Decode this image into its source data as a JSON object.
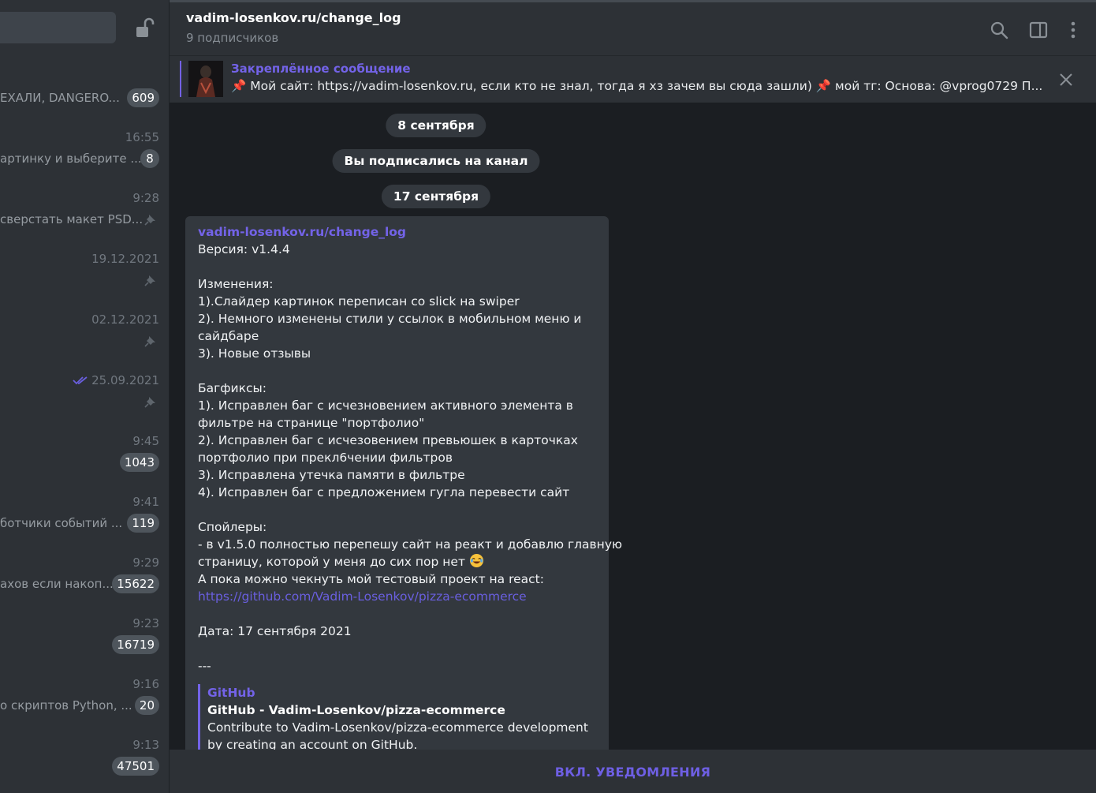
{
  "sidebar": {
    "chats": [
      {
        "time": "",
        "preview": "ЕХАЛИ, DANGERO...",
        "badge": "609",
        "pinned": false,
        "read_check": false
      },
      {
        "time": "16:55",
        "preview": "артинку и выберите ...",
        "badge": "8",
        "pinned": false,
        "read_check": false
      },
      {
        "time": "9:28",
        "preview": "сверстать макет PSD...",
        "badge": "",
        "pinned": true,
        "read_check": false
      },
      {
        "time": "19.12.2021",
        "preview": "",
        "badge": "",
        "pinned": true,
        "read_check": false
      },
      {
        "time": "02.12.2021",
        "preview": "",
        "badge": "",
        "pinned": true,
        "read_check": false
      },
      {
        "time": "25.09.2021",
        "preview": "",
        "badge": "",
        "pinned": true,
        "read_check": true
      },
      {
        "time": "9:45",
        "preview": "",
        "badge": "1043",
        "pinned": false,
        "read_check": false
      },
      {
        "time": "9:41",
        "preview": "ботчики событий ...",
        "badge": "119",
        "pinned": false,
        "read_check": false
      },
      {
        "time": "9:29",
        "preview": "ахов если накоп...",
        "badge": "15622",
        "pinned": false,
        "read_check": false
      },
      {
        "time": "9:23",
        "preview": "",
        "badge": "16719",
        "pinned": false,
        "read_check": false
      },
      {
        "time": "9:16",
        "preview": "о скриптов Python, ...",
        "badge": "20",
        "pinned": false,
        "read_check": false
      },
      {
        "time": "9:13",
        "preview": "",
        "badge": "47501",
        "pinned": false,
        "read_check": false
      }
    ]
  },
  "header": {
    "title": "vadim-losenkov.ru/change_log",
    "subtitle": "9 подписчиков",
    "icons": [
      "search-icon",
      "sidebar-toggle-icon",
      "more-vertical-icon"
    ]
  },
  "pinned": {
    "title": "Закреплённое сообщение",
    "text": "📌 Мой сайт: https://vadim-losenkov.ru, если кто не знал, тогда я хз зачем вы сюда зашли) 📌 мой тг:     Основа: @vprog0729     П..."
  },
  "service": {
    "date1": "8 сентября",
    "subscribed": "Вы подписались на канал",
    "date2": "17 сентября"
  },
  "message": {
    "channel": "vadim-losenkov.ru/change_log",
    "lines": [
      "Версия: v1.4.4",
      "",
      "Изменения:",
      "1).Слайдер картинок переписан со slick на swiper",
      "2). Немного изменены стили у ссылок в мобильном меню и",
      "сайдбаре",
      "3). Новые отзывы",
      "",
      "Багфиксы:",
      "1). Исправлен баг с исчезновением активного элемента в",
      "фильтре на странице \"портфолио\"",
      "2). Исправлен баг с исчезовением превьюшек в карточках",
      "портфолио при прекл6чении фильтров",
      "3). Исправлена утечка памяти в фильтре",
      "4). Исправлен баг с предложением гугла перевести сайт",
      "",
      "Спойлеры:",
      "- в v1.5.0 полностью перепешу сайт на реакт и добавлю главную"
    ],
    "spoiler_line2": "страницу, которой у меня до сих пор нет",
    "react_line": "А пока можно чекнуть мой тестовый проект на react:",
    "link": "https://github.com/Vadim-Losenkov/pizza-ecommerce",
    "date_line": "Дата: 17 сентября 2021",
    "separator": "---",
    "preview": {
      "site": "GitHub",
      "title": "GitHub - Vadim-Losenkov/pizza-ecommerce",
      "desc1": "Contribute to Vadim-Losenkov/pizza-ecommerce development",
      "desc2": "by creating an account on GitHub."
    }
  },
  "bottom": {
    "button_label": "ВКЛ. УВЕДОМЛЕНИЯ"
  },
  "colors": {
    "accent": "#7363e8",
    "badge": "#4e555c",
    "bubble": "#33383e"
  }
}
